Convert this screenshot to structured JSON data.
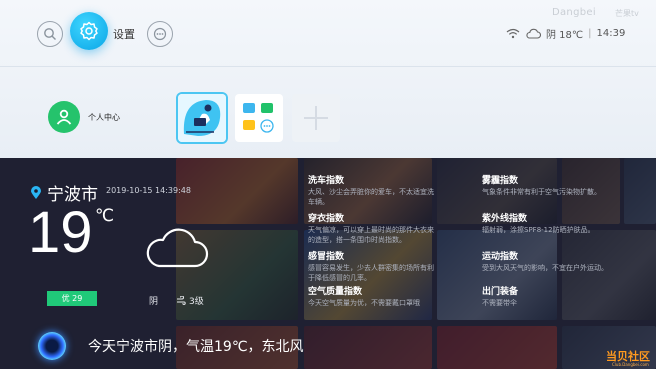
{
  "header": {
    "settings_label": "设置",
    "brand": "Dangbei",
    "brand_cn": "芒果tv",
    "weather": "阴 18℃",
    "time": "14:39"
  },
  "launcher": {
    "user_center_label": "个人中心"
  },
  "weather_card": {
    "city": "宁波市",
    "date": "2019-10-15",
    "time": "14:39:48",
    "temperature": "19",
    "temperature_unit": "℃",
    "aqi_label": "优",
    "aqi_value": "29",
    "condition": "阴",
    "wind": "3级"
  },
  "indices": [
    {
      "title": "洗车指数",
      "desc": "大风、沙尘会弄脏你的爱车，不太适宜洗车辆。"
    },
    {
      "title": "穿衣指数",
      "desc": "天气偏凉，可以穿上最时尚的那件大衣来的造型，搭一条围巾时尚指数。"
    },
    {
      "title": "感冒指数",
      "desc": "感冒容易发生，少去人群密集的场所有利于降低感冒的几率。"
    },
    {
      "title": "空气质量指数",
      "desc": "今天空气质量为优，不需要戴口罩哦"
    },
    {
      "title": "雾霾指数",
      "desc": "气象条件非常有利于空气污染物扩散。"
    },
    {
      "title": "紫外线指数",
      "desc": "辐射弱，涂擦SPF8-12防晒护肤品。"
    },
    {
      "title": "运动指数",
      "desc": "受到大风天气的影响，不宜在户外运动。"
    },
    {
      "title": "出门装备",
      "desc": "不需要带伞"
    }
  ],
  "voice": {
    "text": "今天宁波市阴，气温19℃，东北风"
  },
  "watermark": {
    "text": "当贝社区",
    "url": "Club.Dangbei.com"
  },
  "colors": {
    "accent": "#0aa5e6",
    "user_green": "#25c36c",
    "aqi_green": "#20c979",
    "watermark_orange": "#ff9a1f"
  }
}
